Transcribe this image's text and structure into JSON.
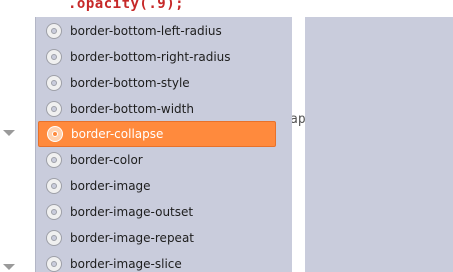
{
  "editor": {
    "code_line": ".opacity(.9);",
    "background_fragment": "ap"
  },
  "autocomplete": {
    "items": [
      {
        "label": "border-bottom-left-radius"
      },
      {
        "label": "border-bottom-right-radius"
      },
      {
        "label": "border-bottom-style"
      },
      {
        "label": "border-bottom-width"
      },
      {
        "label": "border-collapse"
      },
      {
        "label": "border-color"
      },
      {
        "label": "border-image"
      },
      {
        "label": "border-image-outset"
      },
      {
        "label": "border-image-repeat"
      },
      {
        "label": "border-image-slice"
      }
    ],
    "selected_index": 4,
    "item_icon": "gear-icon",
    "colors": {
      "selected_bg": "#ff8a3d",
      "popup_bg": "#c9ccdc"
    }
  }
}
